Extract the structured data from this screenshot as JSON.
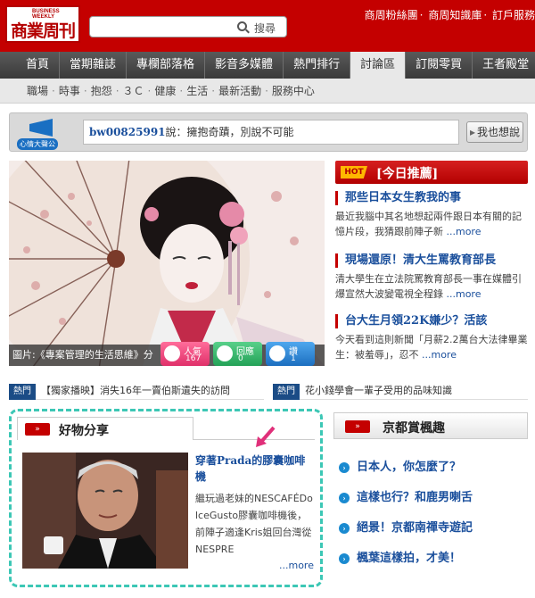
{
  "header": {
    "logo_small": "BUSINESS WEEKLY",
    "logo_big": "商業周刊",
    "search_button_label": "搜尋",
    "top_links": [
      "商周粉絲團",
      "商周知識庫",
      "訂戶服務"
    ]
  },
  "main_nav": [
    "首頁",
    "當期雜誌",
    "專欄部落格",
    "影音多媒體",
    "熱門排行",
    "討論區",
    "訂閱零買",
    "王者殿堂"
  ],
  "main_nav_active": "討論區",
  "sub_nav": [
    "職場",
    "時事",
    "抱怨",
    "３Ｃ",
    "健康",
    "生活",
    "最新活動",
    "服務中心"
  ],
  "shout": {
    "icon_caption": "心情大聲公",
    "user": "bw00825991",
    "said": "說：擁抱奇蹟，別說不可能",
    "button_label": "我也想說"
  },
  "feature": {
    "caption": "圖片:《專案管理的生活思維》分",
    "stats": {
      "views_label": "人氣",
      "views_count": "167",
      "replies_label": "回應",
      "replies_count": "0",
      "likes_label": "讚",
      "likes_count": "1"
    }
  },
  "today": {
    "badge": "HOT",
    "title": "[今日推薦]",
    "more_label": "...more",
    "items": [
      {
        "title": "那些日本女生教我的事",
        "desc": "最近我腦中其名地想起兩件跟日本有關的記憶片段，我猜跟前陣子新"
      },
      {
        "title": "現場還原！清大生罵教育部長",
        "desc": "清大學生在立法院罵教育部長一事在媒體引爆宣然大波變電視全程錄"
      },
      {
        "title": "台大生月領22K嫌少？活該",
        "desc": "今天看到這則新聞「月薪2.2萬台大法律畢業生：被羞辱」，忍不"
      }
    ]
  },
  "ticker": [
    {
      "tag": "熱門",
      "text": "【獨家播映】消失16年一賣伯斯遺失的訪問"
    },
    {
      "tag": "熱門",
      "text": "花小錢學會一輩子受用的品味知識"
    }
  ],
  "goods": {
    "title": "好物分享",
    "headline": "穿著Prada的膠囊咖啡機",
    "desc": "繼玩過老妹的NESCAFÉDolceGusto膠囊咖啡機後，前陣子適逢Kris姐回台灣從NESPRE",
    "more_label": "...more"
  },
  "kyoto": {
    "title": "京都賞楓趣",
    "items": [
      "日本人，你怎麼了？",
      "這樣也行？和鹿男喇舌",
      "絕景！京都南禪寺遊記",
      "楓葉這樣拍，才美！"
    ]
  },
  "colors": {
    "brand_red": "#c40000",
    "link_blue": "#1a4f9c",
    "dashed_teal": "#3cc7b5",
    "tag_navy": "#1b4c86"
  }
}
